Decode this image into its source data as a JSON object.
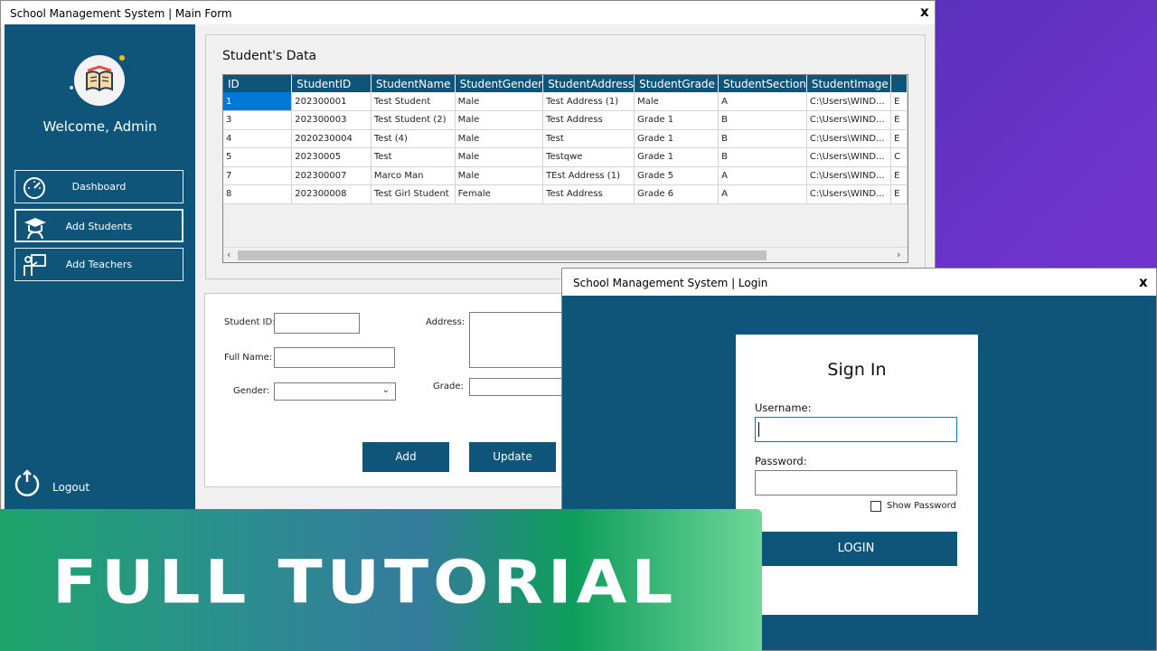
{
  "main_window": {
    "title": "School Management System | Main Form",
    "close_label": "x"
  },
  "sidebar": {
    "welcome": "Welcome, Admin",
    "items": [
      {
        "label": "Dashboard",
        "icon": "speedometer-icon"
      },
      {
        "label": "Add Students",
        "icon": "graduate-icon"
      },
      {
        "label": "Add Teachers",
        "icon": "teacher-board-icon"
      }
    ],
    "logout_label": "Logout",
    "logo_icon": "open-book-icon"
  },
  "students_group": {
    "title": "Student's Data",
    "columns": [
      "ID",
      "StudentID",
      "StudentName",
      "StudentGender",
      "StudentAddress",
      "StudentGrade",
      "StudentSection",
      "StudentImage",
      ""
    ],
    "rows": [
      [
        "1",
        "202300001",
        "Test Student",
        "Male",
        "Test Address (1)",
        "Male",
        "A",
        "C:\\Users\\WIND...",
        "E"
      ],
      [
        "3",
        "202300003",
        "Test Student (2)",
        "Male",
        "Test Address",
        "Grade 1",
        "B",
        "C:\\Users\\WIND...",
        "E"
      ],
      [
        "4",
        "2020230004",
        "Test (4)",
        "Male",
        "Test",
        "Grade 1",
        "B",
        "C:\\Users\\WIND...",
        "E"
      ],
      [
        "5",
        "20230005",
        "Test",
        "Male",
        "Testqwe",
        "Grade 1",
        "B",
        "C:\\Users\\WIND...",
        "C"
      ],
      [
        "7",
        "202300007",
        "Marco Man",
        "Male",
        "TEst Address (1)",
        "Grade 5",
        "A",
        "C:\\Users\\WIND...",
        "E"
      ],
      [
        "8",
        "202300008",
        "Test Girl Student",
        "Female",
        "Test Address",
        "Grade 6",
        "A",
        "C:\\Users\\WIND...",
        "E"
      ]
    ],
    "selected_row": 0
  },
  "form": {
    "student_id_label": "Student ID:",
    "full_name_label": "Full Name:",
    "gender_label": "Gender:",
    "address_label": "Address:",
    "grade_label": "Grade:",
    "student_id_value": "",
    "full_name_value": "",
    "gender_value": "",
    "address_value": "",
    "grade_value": "",
    "add_label": "Add",
    "update_label": "Update"
  },
  "login_window": {
    "title": "School Management System | Login",
    "close_label": "x",
    "heading": "Sign In",
    "username_label": "Username:",
    "password_label": "Password:",
    "username_value": "",
    "password_value": "",
    "show_password_label": "Show Password",
    "show_password_checked": false,
    "login_label": "LOGIN"
  },
  "banner": {
    "text": "FULL TUTORIAL"
  },
  "colors": {
    "primary": "#0f5579",
    "selection": "#0078d7",
    "banner_green": "#1ea46a",
    "background_purple": "#6c34c9"
  }
}
